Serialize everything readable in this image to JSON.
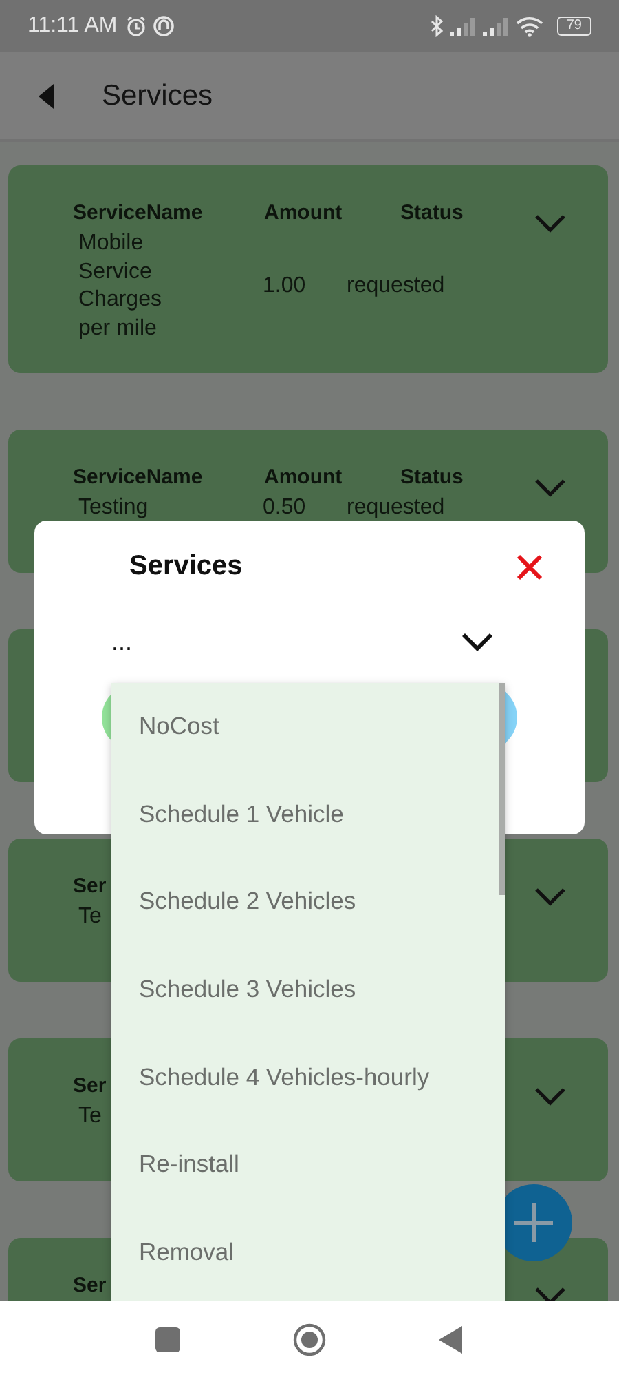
{
  "status_bar": {
    "time": "11:11 AM",
    "battery": "79"
  },
  "app_bar": {
    "title": "Services"
  },
  "cards": [
    {
      "kind": "service",
      "columns": [
        "ServiceName",
        "Amount",
        "Status"
      ],
      "row": [
        "Mobile Service Charges per mile",
        "1.00",
        "requested"
      ]
    },
    {
      "kind": "service",
      "columns": [
        "ServiceName",
        "Amount",
        "Status"
      ],
      "row": [
        "Testing",
        "0.50",
        "requested"
      ]
    },
    {
      "kind": "covered"
    },
    {
      "kind": "service",
      "columns": [
        "Ser"
      ],
      "row": [
        "Te"
      ]
    },
    {
      "kind": "service",
      "columns": [
        "Ser"
      ],
      "row": [
        "Te"
      ]
    },
    {
      "kind": "service",
      "columns": [
        "Ser"
      ]
    }
  ],
  "dialog": {
    "title": "Services",
    "select": {
      "value": "..."
    },
    "buttons": [
      {
        "color": "#93e39a"
      },
      {
        "color": "#86d3f7"
      }
    ]
  },
  "dropdown": {
    "options": [
      "NoCost",
      "Schedule 1 Vehicle",
      "Schedule 2 Vehicles",
      "Schedule 3 Vehicles",
      "Schedule 4 Vehicles-hourly",
      "Re-install",
      "Removal"
    ]
  }
}
